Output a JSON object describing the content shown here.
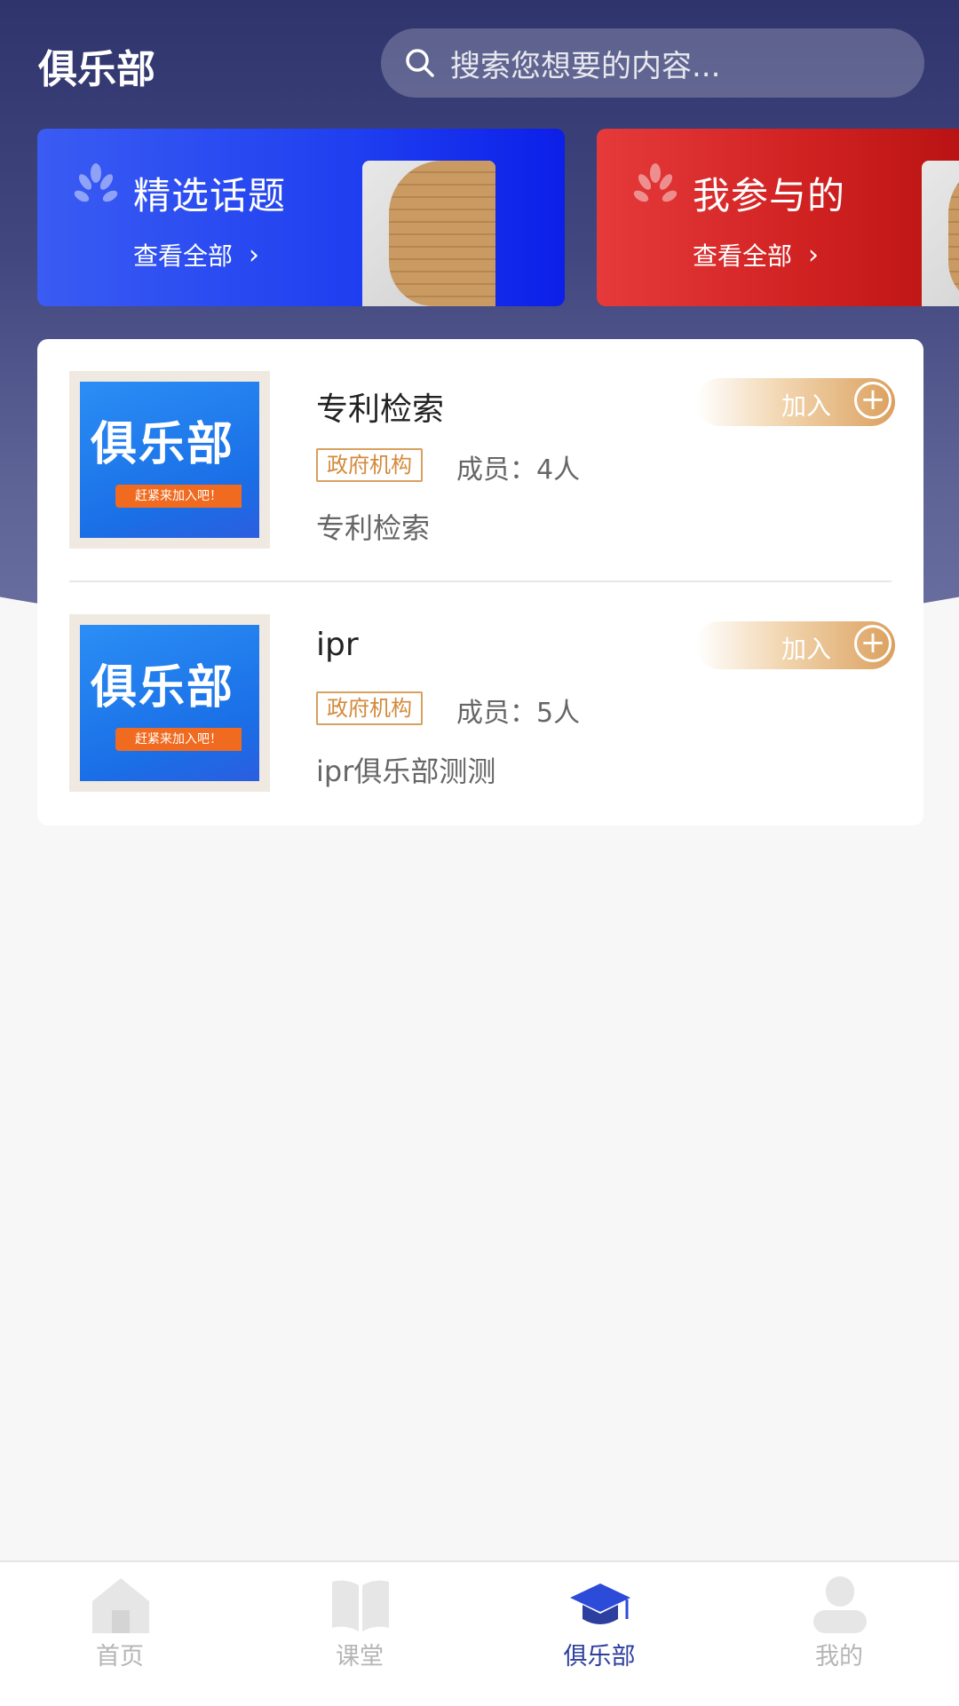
{
  "header": {
    "title": "俱乐部"
  },
  "search": {
    "placeholder": "搜索您想要的内容..."
  },
  "banners": [
    {
      "title": "精选话题",
      "link": "查看全部",
      "color": "#1f3ff0"
    },
    {
      "title": "我参与的",
      "link": "查看全部",
      "color": "#cf2020"
    }
  ],
  "clubs": [
    {
      "thumb_title": "俱乐部",
      "thumb_tag": "赶紧来加入吧！",
      "name": "专利检索",
      "tag": "政府机构",
      "members": "成员：4人",
      "desc": "专利检索",
      "join_label": "加入"
    },
    {
      "thumb_title": "俱乐部",
      "thumb_tag": "赶紧来加入吧！",
      "name": "ipr",
      "tag": "政府机构",
      "members": "成员：5人",
      "desc": "ipr俱乐部测测",
      "join_label": "加入"
    }
  ],
  "tabbar": {
    "items": [
      {
        "label": "首页",
        "icon": "home-icon",
        "active": false
      },
      {
        "label": "课堂",
        "icon": "book-icon",
        "active": false
      },
      {
        "label": "俱乐部",
        "icon": "graduation-cap-icon",
        "active": true
      },
      {
        "label": "我的",
        "icon": "user-icon",
        "active": false
      }
    ]
  },
  "colors": {
    "accent": "#2c3e9e",
    "join_gold": "#dba05e",
    "tag_orange": "#d48a3c"
  }
}
